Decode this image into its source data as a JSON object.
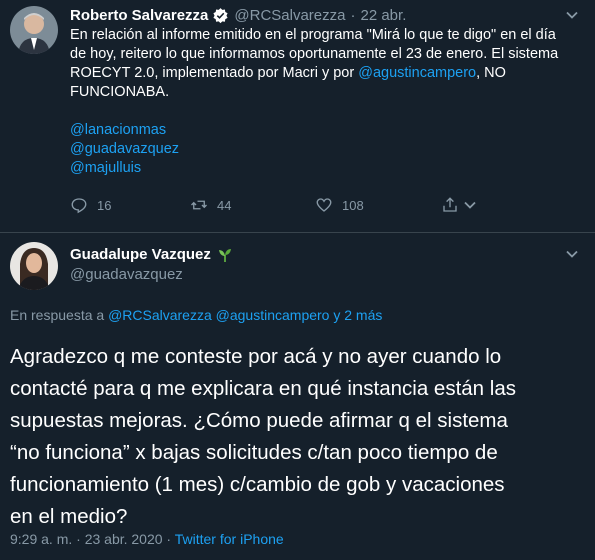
{
  "colors": {
    "background": "#15202b",
    "text": "#ffffff",
    "muted": "#8899a6",
    "link": "#1da1f2",
    "verified": "#ffffff",
    "divider": "#38444d"
  },
  "tweet1": {
    "display_name": "Roberto Salvarezza",
    "verified_icon": "verified-badge-icon",
    "handle": "@RCSalvarezza",
    "date": "22 abr.",
    "text_line1": "En relación al informe emitido en el programa \"Mirá lo que te digo\" en el día",
    "text_line2": "de hoy, reitero lo que informamos oportunamente el 23 de enero. El sistema",
    "text_line3_pre": "ROECYT 2.0, implementado por Macri y por ",
    "text_line3_mention": "@agustincampero",
    "text_line3_post": ", NO",
    "text_line4": "FUNCIONABA.",
    "mentions": [
      "@lanacionmas",
      "@guadavazquez",
      "@majulluis"
    ],
    "actions": {
      "reply_count": "16",
      "retweet_count": "44",
      "like_count": "108"
    }
  },
  "tweet2": {
    "display_name": "Guadalupe Vazquez",
    "name_emoji_icon": "seedling-icon",
    "handle": "@guadavazquez",
    "reply_to_prefix": "En respuesta a ",
    "reply_to_mentions": "@RCSalvarezza @agustincampero",
    "reply_to_more": " y 2 más",
    "text_lines": [
      "Agradezco q me conteste por acá y no ayer cuando lo",
      "contacté para q me explicara en qué instancia están las",
      "supuestas mejoras. ¿Cómo puede afirmar q el sistema",
      "“no funciona” x bajas solicitudes c/tan poco tiempo de",
      "funcionamiento (1 mes) c/cambio de gob y vacaciones",
      "en el medio?"
    ],
    "timestamp": "9:29 a. m. · 23 abr. 2020 · ",
    "source": "Twitter for iPhone"
  }
}
